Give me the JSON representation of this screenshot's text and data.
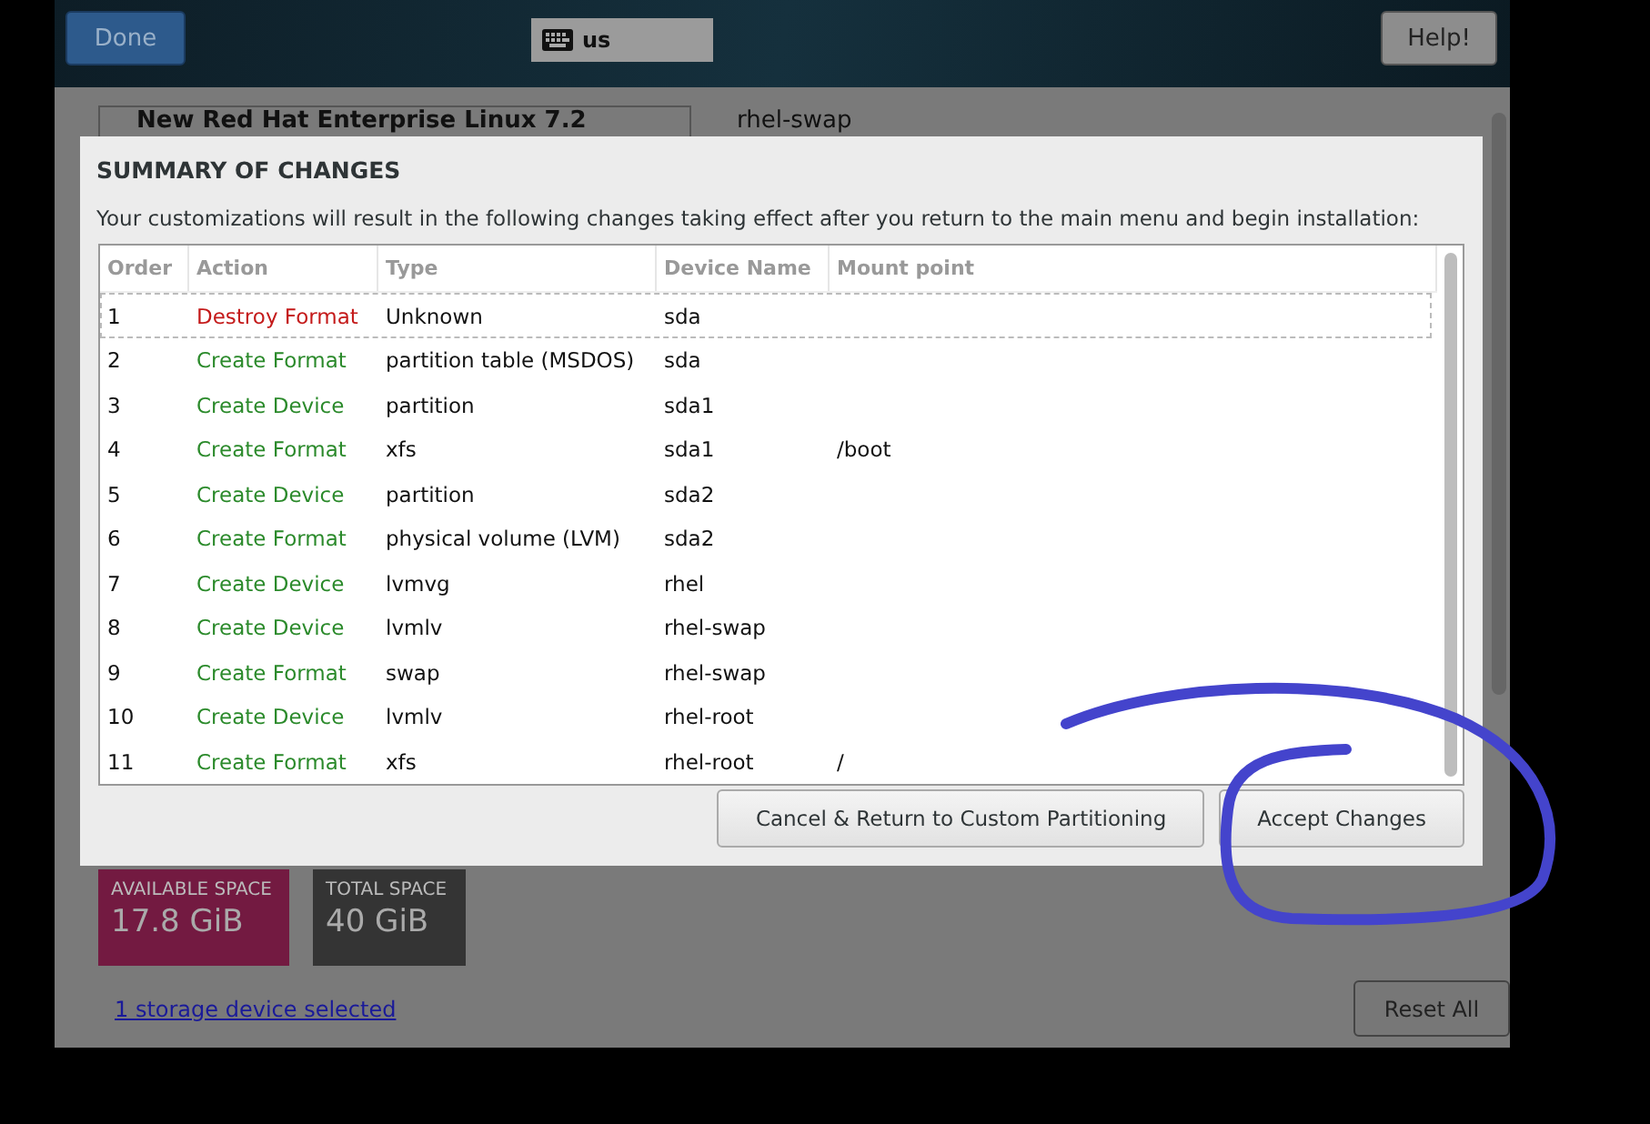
{
  "top_bar": {
    "done_button": "Done",
    "keyboard_layout": "us",
    "help_button": "Help!"
  },
  "background": {
    "system_name": "New Red Hat Enterprise Linux 7.2",
    "device_heading": "rhel-swap",
    "available_space": {
      "label": "AVAILABLE SPACE",
      "value": "17.8 GiB"
    },
    "total_space": {
      "label": "TOTAL SPACE",
      "value": "40 GiB"
    },
    "storage_link": "1 storage device selected",
    "reset_button": "Reset All"
  },
  "dialog": {
    "title": "SUMMARY OF CHANGES",
    "description": "Your customizations will result in the following changes taking effect after you return to the main menu and begin installation:",
    "table": {
      "columns": [
        "Order",
        "Action",
        "Type",
        "Device Name",
        "Mount point"
      ],
      "rows": [
        {
          "order": "1",
          "action": "Destroy Format",
          "kind": "destroy",
          "type": "Unknown",
          "device": "sda",
          "mount": "",
          "selected": true
        },
        {
          "order": "2",
          "action": "Create Format",
          "kind": "create",
          "type": "partition table (MSDOS)",
          "device": "sda",
          "mount": "",
          "selected": false
        },
        {
          "order": "3",
          "action": "Create Device",
          "kind": "create",
          "type": "partition",
          "device": "sda1",
          "mount": "",
          "selected": false
        },
        {
          "order": "4",
          "action": "Create Format",
          "kind": "create",
          "type": "xfs",
          "device": "sda1",
          "mount": "/boot",
          "selected": false
        },
        {
          "order": "5",
          "action": "Create Device",
          "kind": "create",
          "type": "partition",
          "device": "sda2",
          "mount": "",
          "selected": false
        },
        {
          "order": "6",
          "action": "Create Format",
          "kind": "create",
          "type": "physical volume (LVM)",
          "device": "sda2",
          "mount": "",
          "selected": false
        },
        {
          "order": "7",
          "action": "Create Device",
          "kind": "create",
          "type": "lvmvg",
          "device": "rhel",
          "mount": "",
          "selected": false
        },
        {
          "order": "8",
          "action": "Create Device",
          "kind": "create",
          "type": "lvmlv",
          "device": "rhel-swap",
          "mount": "",
          "selected": false
        },
        {
          "order": "9",
          "action": "Create Format",
          "kind": "create",
          "type": "swap",
          "device": "rhel-swap",
          "mount": "",
          "selected": false
        },
        {
          "order": "10",
          "action": "Create Device",
          "kind": "create",
          "type": "lvmlv",
          "device": "rhel-root",
          "mount": "",
          "selected": false
        },
        {
          "order": "11",
          "action": "Create Format",
          "kind": "create",
          "type": "xfs",
          "device": "rhel-root",
          "mount": "/",
          "selected": false
        }
      ]
    },
    "buttons": [
      "Cancel & Return to Custom Partitioning",
      "Accept Changes"
    ]
  }
}
